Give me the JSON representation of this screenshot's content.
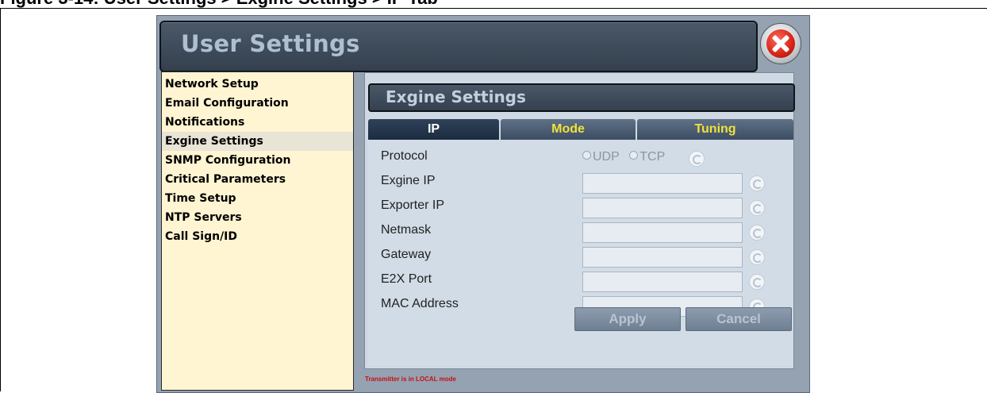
{
  "page_heading": "Figure 3-14: User Settings > Exgine Settings > IP Tab",
  "window": {
    "title": "User Settings"
  },
  "sidebar": {
    "items": [
      {
        "label": "Network Setup",
        "active": false
      },
      {
        "label": "Email Configuration",
        "active": false
      },
      {
        "label": "Notifications",
        "active": false
      },
      {
        "label": "Exgine Settings",
        "active": true
      },
      {
        "label": "SNMP Configuration",
        "active": false
      },
      {
        "label": "Critical Parameters",
        "active": false
      },
      {
        "label": "Time Setup",
        "active": false
      },
      {
        "label": "NTP Servers",
        "active": false
      },
      {
        "label": "Call Sign/ID",
        "active": false
      }
    ]
  },
  "section": {
    "title": "Exgine Settings"
  },
  "tabs": [
    {
      "label": "IP",
      "active": true
    },
    {
      "label": "Mode",
      "active": false
    },
    {
      "label": "Tuning",
      "active": false
    }
  ],
  "form": {
    "protocol_label": "Protocol",
    "protocol_options": [
      "UDP",
      "TCP"
    ],
    "fields": [
      {
        "label": "Exgine IP",
        "value": ""
      },
      {
        "label": "Exporter IP",
        "value": ""
      },
      {
        "label": "Netmask",
        "value": ""
      },
      {
        "label": "Gateway",
        "value": ""
      },
      {
        "label": "E2X Port",
        "value": ""
      },
      {
        "label": "MAC Address",
        "value": ""
      }
    ]
  },
  "buttons": {
    "apply": "Apply",
    "cancel": "Cancel"
  },
  "status": {
    "text": "Transmitter is in LOCAL mode"
  },
  "colors": {
    "sidebar_bg": "#fff5d2",
    "tab_label": "#f1e23a",
    "status_text": "#c81010"
  }
}
